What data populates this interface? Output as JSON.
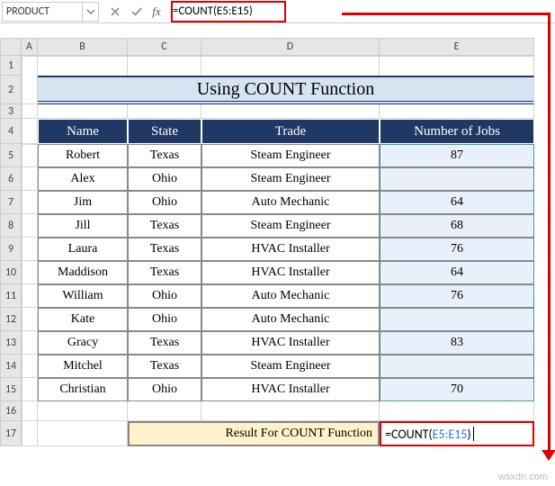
{
  "name_box": "PRODUCT",
  "formula_bar": "=COUNT(E5:E15)",
  "columns": [
    "A",
    "B",
    "C",
    "D",
    "E"
  ],
  "rows_visible": [
    1,
    2,
    3,
    4,
    5,
    6,
    7,
    8,
    9,
    10,
    11,
    12,
    13,
    14,
    15,
    16,
    17
  ],
  "title": "Using COUNT Function",
  "headers": {
    "name": "Name",
    "state": "State",
    "trade": "Trade",
    "jobs": "Number of Jobs"
  },
  "data": [
    {
      "name": "Robert",
      "state": "Texas",
      "trade": "Steam Engineer",
      "jobs": "87"
    },
    {
      "name": "Alex",
      "state": "Ohio",
      "trade": "Steam Engineer",
      "jobs": ""
    },
    {
      "name": "Jim",
      "state": "Ohio",
      "trade": "Auto Mechanic",
      "jobs": "64"
    },
    {
      "name": "Jill",
      "state": "Texas",
      "trade": "Steam Engineer",
      "jobs": "68"
    },
    {
      "name": "Laura",
      "state": "Texas",
      "trade": "HVAC Installer",
      "jobs": "76"
    },
    {
      "name": "Maddison",
      "state": "Texas",
      "trade": "HVAC Installer",
      "jobs": "64"
    },
    {
      "name": "William",
      "state": "Ohio",
      "trade": "Auto Mechanic",
      "jobs": "76"
    },
    {
      "name": "Kate",
      "state": "Ohio",
      "trade": "Auto Mechanic",
      "jobs": ""
    },
    {
      "name": "Gracy",
      "state": "Texas",
      "trade": "HVAC Installer",
      "jobs": "83"
    },
    {
      "name": "Mitchel",
      "state": "Texas",
      "trade": "Steam Engineer",
      "jobs": ""
    },
    {
      "name": "Christian",
      "state": "Ohio",
      "trade": "HVAC Installer",
      "jobs": "70"
    }
  ],
  "result_label": "Result For COUNT Function",
  "result_formula_prefix": "=COUNT(",
  "result_formula_range": "E5:E15",
  "result_formula_suffix": ")",
  "watermark": "wsxdn.com"
}
